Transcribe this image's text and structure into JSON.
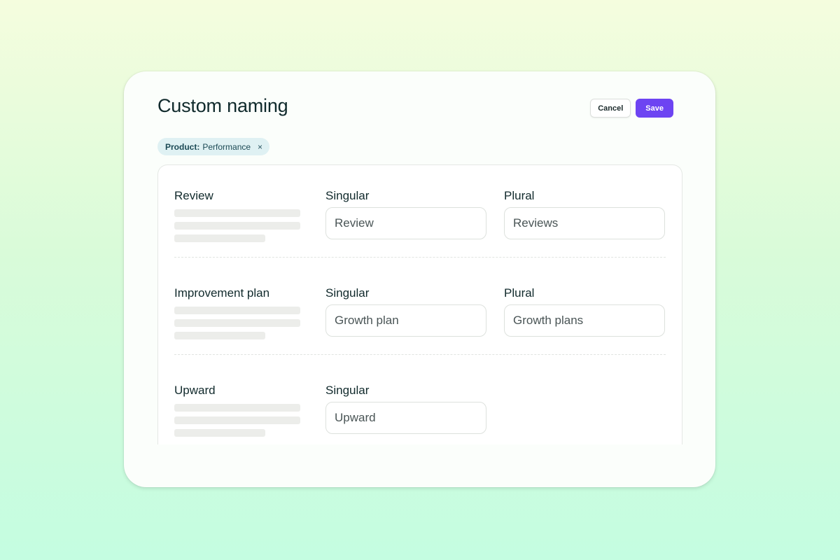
{
  "header": {
    "title": "Custom naming",
    "cancel_label": "Cancel",
    "save_label": "Save"
  },
  "filter": {
    "key": "Product:",
    "value": "Performance",
    "close_icon": "×"
  },
  "colors": {
    "accent": "#6d44f2",
    "chip_bg": "#dff1f3"
  },
  "rows": [
    {
      "title": "Review",
      "singular_label": "Singular",
      "singular_value": "Review",
      "plural_label": "Plural",
      "plural_value": "Reviews"
    },
    {
      "title": "Improvement plan",
      "singular_label": "Singular",
      "singular_value": "Growth plan",
      "plural_label": "Plural",
      "plural_value": "Growth plans"
    },
    {
      "title": "Upward",
      "singular_label": "Singular",
      "singular_value": "Upward"
    }
  ]
}
